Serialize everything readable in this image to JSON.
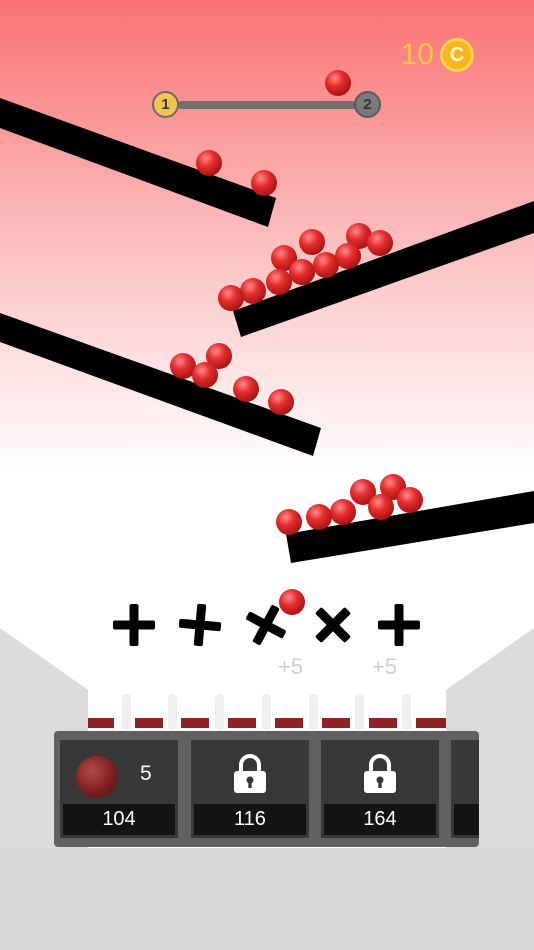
{
  "hud": {
    "coins": "10",
    "coin_symbol": "C",
    "level_current": "1",
    "level_next": "2"
  },
  "bonuses": [
    "+5",
    "+5"
  ],
  "shop": {
    "cards": [
      {
        "count": "5",
        "price": "104",
        "locked": false
      },
      {
        "price": "116",
        "locked": true
      },
      {
        "price": "164",
        "locked": true
      }
    ]
  },
  "colors": {
    "ball": "#e0282a",
    "coin": "#f6b81c",
    "ramp": "#000000",
    "sky_top": "#f97777"
  }
}
